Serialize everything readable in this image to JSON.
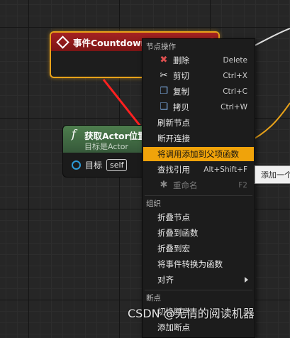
{
  "event_node": {
    "title": "事件Countdown Has Finished"
  },
  "function_node": {
    "icon": "f",
    "title": "获取Actor位置",
    "subtitle": "目标是Actor",
    "pin_label": "目标",
    "pin_value": "self"
  },
  "context_menu": {
    "section_node_ops": "节点操作",
    "items_node_ops": [
      {
        "icon": "delete-icon",
        "glyph": "✖",
        "label": "删除",
        "shortcut": "Delete"
      },
      {
        "icon": "scissors-icon",
        "glyph": "✂",
        "label": "剪切",
        "shortcut": "Ctrl+X"
      },
      {
        "icon": "copy-icon",
        "glyph": "❐",
        "label": "复制",
        "shortcut": "Ctrl+C"
      },
      {
        "icon": "duplicate-icon",
        "glyph": "❏",
        "label": "拷贝",
        "shortcut": "Ctrl+W"
      }
    ],
    "refresh_nodes": "刷新节点",
    "break_links": "断开连接",
    "add_parent_call": "将调用添加到父项函数",
    "find_references": "查找引用",
    "find_references_shortcut": "Alt+Shift+F",
    "rename": "重命名",
    "rename_shortcut": "F2",
    "section_organize": "组织",
    "collapse_nodes": "折叠节点",
    "collapse_to_function": "折叠到函数",
    "collapse_to_macro": "折叠到宏",
    "convert_event_to_function": "将事件转换为函数",
    "align": "对齐",
    "section_breakpoints": "断点",
    "toggle_breakpoint": "切换断点",
    "add_breakpoint": "添加断点"
  },
  "tooltip": {
    "text": "添加一个"
  },
  "watermark": {
    "text": "CSDN @无情的阅读机器"
  },
  "colors": {
    "highlight": "#f0a30a",
    "event_header": "#a52222",
    "function_header": "#4d7d4d",
    "selection_border": "#e8a21a",
    "annotation_arrow": "#ff2020"
  }
}
